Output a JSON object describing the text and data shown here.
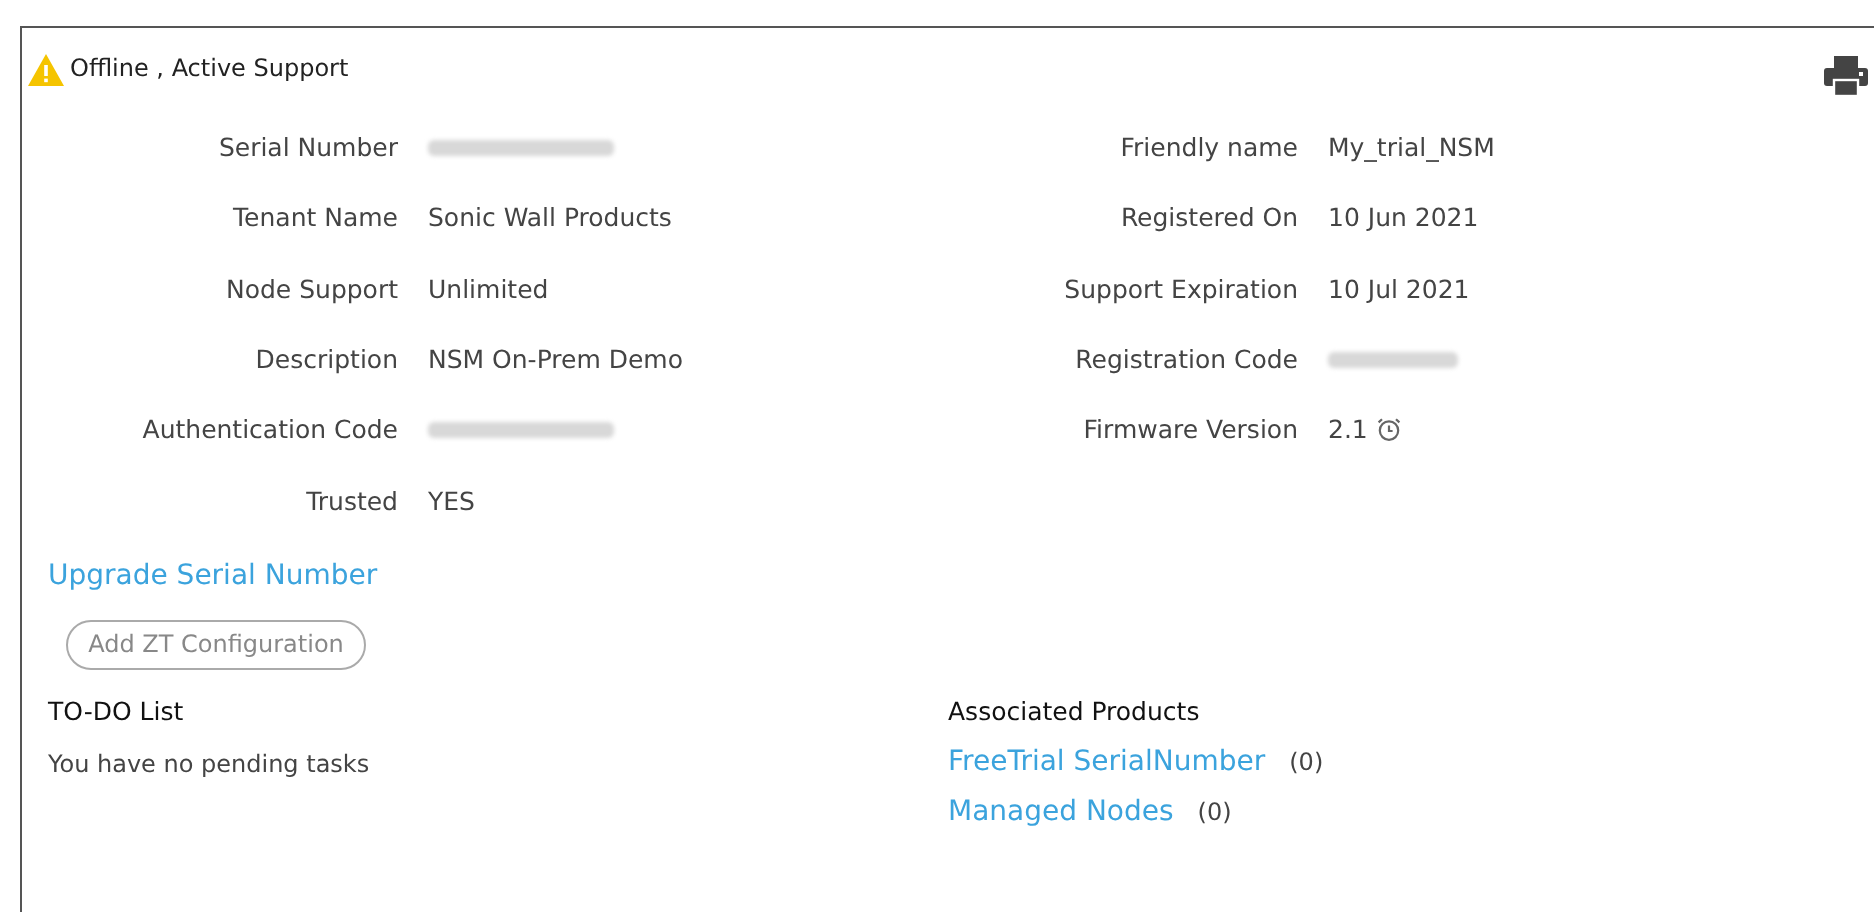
{
  "status": {
    "text": "Offline , Active Support",
    "warning": true
  },
  "details_left": [
    {
      "label": "Serial Number",
      "kind": "redacted"
    },
    {
      "label": "Tenant Name",
      "kind": "text",
      "value": "Sonic Wall Products"
    },
    {
      "label": "Node Support",
      "kind": "text",
      "value": "Unlimited"
    },
    {
      "label": "Description",
      "kind": "text",
      "value": "NSM On-Prem Demo"
    },
    {
      "label": "Authentication Code",
      "kind": "redacted"
    },
    {
      "label": "Trusted",
      "kind": "text",
      "value": "YES"
    }
  ],
  "details_right": [
    {
      "label": "Friendly name",
      "kind": "text",
      "value": "My_trial_NSM"
    },
    {
      "label": "Registered On",
      "kind": "text",
      "value": "10 Jun 2021"
    },
    {
      "label": "Support Expiration",
      "kind": "text",
      "value": "10 Jul 2021"
    },
    {
      "label": "Registration Code",
      "kind": "redacted"
    },
    {
      "label": "Firmware Version",
      "kind": "text",
      "value": "2.1",
      "alarm": true
    }
  ],
  "upgrade_link": "Upgrade Serial Number",
  "add_button": {
    "label": "Add ZT Configuration",
    "disabled": true
  },
  "todo": {
    "title": "TO-DO List",
    "message": "You have no pending tasks"
  },
  "associated": {
    "title": "Associated Products",
    "items": [
      {
        "label": "FreeTrial SerialNumber",
        "count": "(0)"
      },
      {
        "label": "Managed Nodes",
        "count": "(0)"
      }
    ]
  }
}
